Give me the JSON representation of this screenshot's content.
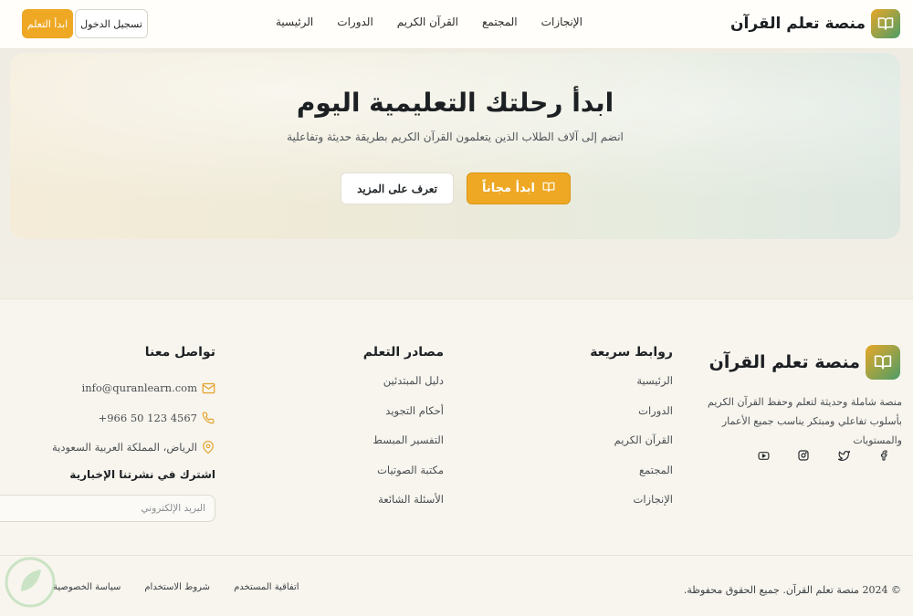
{
  "header": {
    "brand": "منصة تعلم القرآن",
    "nav": [
      "الرئيسية",
      "الدورات",
      "القرآن الكريم",
      "المجتمع",
      "الإنجازات"
    ],
    "login_label": "تسجيل الدخول",
    "start_label": "ابدأ التعلم"
  },
  "hero": {
    "title": "ابدأ رحلتك التعليمية اليوم",
    "subtitle": "انضم إلى آلاف الطلاب الذين يتعلمون القرآن الكريم بطريقة حديثة وتفاعلية",
    "primary_button": "ابدأ مجاناً",
    "secondary_button": "تعرف على المزيد"
  },
  "footer": {
    "brand": "منصة تعلم القرآن",
    "description": "منصة شاملة وحديثة لتعلم وحفظ القرآن الكريم بأسلوب تفاعلي ومبتكر يناسب جميع الأعمار والمستويات",
    "socials": [
      "facebook-icon",
      "twitter-icon",
      "instagram-icon",
      "youtube-icon"
    ],
    "quick_links": {
      "title": "روابط سريعة",
      "items": [
        "الرئيسية",
        "الدورات",
        "القرآن الكريم",
        "المجتمع",
        "الإنجازات"
      ]
    },
    "resources": {
      "title": "مصادر التعلم",
      "items": [
        "دليل المبتدئين",
        "أحكام التجويد",
        "التفسير المبسط",
        "مكتبة الصوتيات",
        "الأسئلة الشائعة"
      ]
    },
    "contact": {
      "title": "تواصل معنا",
      "email": "info@quranlearn.com",
      "phone": "+966 50 123 4567",
      "location": "الرياض، المملكة العربية السعودية",
      "newsletter_title": "اشترك في نشرتنا الإخبارية",
      "email_placeholder": "البريد الإلكتروني"
    },
    "copyright": "© 2024 منصة تعلم القرآن. جميع الحقوق محفوظة.",
    "legal": [
      "سياسة الخصوصية",
      "شروط الاستخدام",
      "اتفاقية المستخدم"
    ]
  },
  "colors": {
    "accent": "#eea824",
    "brand_green": "#4d9d67",
    "background": "#f6f3ea"
  }
}
